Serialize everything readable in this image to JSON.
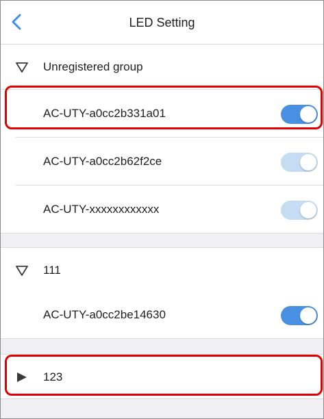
{
  "header": {
    "title": "LED Setting",
    "back_icon": "chevron-left-icon"
  },
  "groups": [
    {
      "name": "Unregistered group",
      "expanded": true,
      "devices": [
        {
          "name": "AC-UTY-a0cc2b331a01",
          "on": true,
          "enabled": true
        },
        {
          "name": "AC-UTY-a0cc2b62f2ce",
          "on": true,
          "enabled": false
        },
        {
          "name": "AC-UTY-xxxxxxxxxxxx",
          "on": true,
          "enabled": false
        }
      ]
    },
    {
      "name": "111",
      "expanded": true,
      "devices": [
        {
          "name": "AC-UTY-a0cc2be14630",
          "on": true,
          "enabled": true
        }
      ]
    },
    {
      "name": "123",
      "expanded": false,
      "devices": []
    }
  ],
  "colors": {
    "accent": "#4a90e2",
    "toggle_disabled": "#c5dcf3",
    "highlight": "#e00000",
    "section_gap": "#efeff4"
  }
}
